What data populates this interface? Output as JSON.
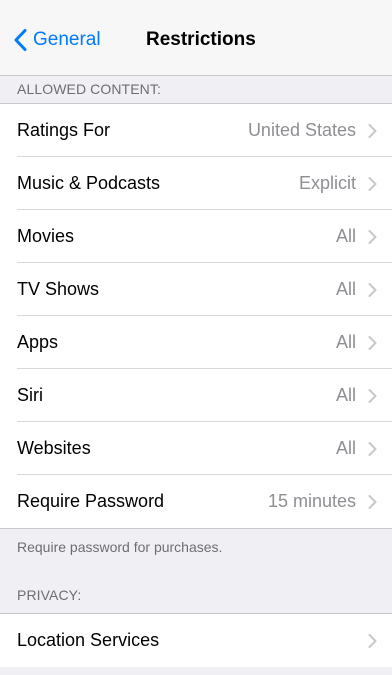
{
  "navbar": {
    "back_label": "General",
    "title": "Restrictions"
  },
  "allowed_content": {
    "header": "ALLOWED CONTENT:",
    "rows": [
      {
        "label": "Ratings For",
        "value": "United States"
      },
      {
        "label": "Music & Podcasts",
        "value": "Explicit"
      },
      {
        "label": "Movies",
        "value": "All"
      },
      {
        "label": "TV Shows",
        "value": "All"
      },
      {
        "label": "Apps",
        "value": "All"
      },
      {
        "label": "Siri",
        "value": "All"
      },
      {
        "label": "Websites",
        "value": "All"
      },
      {
        "label": "Require Password",
        "value": "15 minutes"
      }
    ],
    "footer": "Require password for purchases."
  },
  "privacy": {
    "header": "PRIVACY:",
    "rows": [
      {
        "label": "Location Services",
        "value": ""
      }
    ]
  },
  "colors": {
    "accent": "#007aff",
    "background": "#efeff4",
    "secondary_text": "#8e8e93",
    "header_text": "#6d6d72",
    "separator": "#c8c7cc"
  },
  "icons": {
    "back": "chevron-left-icon",
    "disclosure": "chevron-right-icon"
  }
}
